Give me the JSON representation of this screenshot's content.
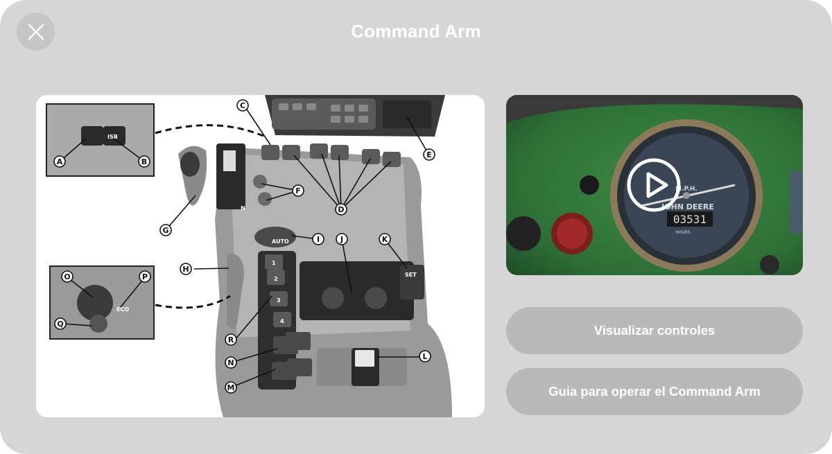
{
  "dialog": {
    "title": "Command Arm",
    "close_icon": "close-icon"
  },
  "diagram": {
    "callouts": [
      "A",
      "B",
      "C",
      "D",
      "E",
      "F",
      "G",
      "H",
      "I",
      "J",
      "K",
      "L",
      "M",
      "N",
      "O",
      "P",
      "Q",
      "R"
    ],
    "panel_labels": {
      "isb": "ISB",
      "set": "SET",
      "auto": "AUTO",
      "eco": "ECO",
      "n": "N",
      "range_buttons": [
        "1",
        "2",
        "3",
        "4"
      ]
    }
  },
  "video": {
    "play_icon": "play-icon",
    "gauge_brand": "JOHN DEERE",
    "gauge_unit": "M.P.H.",
    "hours_counter": "03531",
    "hours_label": "HOURS"
  },
  "actions": {
    "view_controls": "Visualizar controles",
    "operator_guide": "Guia para operar el Command Arm"
  }
}
